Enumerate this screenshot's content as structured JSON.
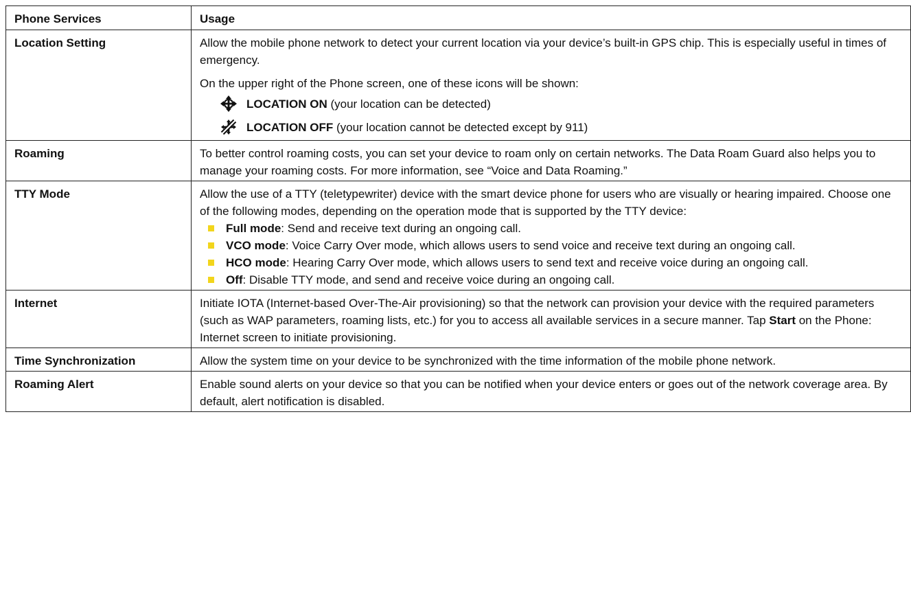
{
  "header": {
    "col1": "Phone Services",
    "col2": "Usage"
  },
  "rows": {
    "location": {
      "label": "Location Setting",
      "p1": "Allow the mobile phone network to detect your current location via your device’s built-in GPS chip. This is especially useful in times of emergency.",
      "p2": "On the upper right of the Phone screen, one of these icons will be shown:",
      "on_bold": "LOCATION ON",
      "on_text": " (your location can be detected)",
      "off_bold": "LOCATION OFF",
      "off_text": " (your location cannot be detected except by 911)"
    },
    "roaming": {
      "label": "Roaming",
      "text": "To better control roaming costs, you can set your device to roam only on certain networks. The Data Roam Guard also helps you to manage your roaming costs. For more information, see “Voice and Data Roaming.”"
    },
    "tty": {
      "label": "TTY Mode",
      "intro": "Allow the use of a TTY (teletypewriter) device with the smart device phone for users who are visually or hearing impaired. Choose one of the following modes, depending on the operation mode that is supported by the TTY device:",
      "bullets": [
        {
          "term": "Full mode",
          "text": ": Send and receive text during an ongoing call."
        },
        {
          "term": "VCO mode",
          "text": ": Voice Carry Over mode, which allows users to send voice and receive text during an ongoing call."
        },
        {
          "term": "HCO mode",
          "text": ": Hearing Carry Over mode, which allows users to send text and receive voice during an ongoing call."
        },
        {
          "term": "Off",
          "text": ": Disable TTY mode, and send and receive voice during an ongoing call."
        }
      ]
    },
    "internet": {
      "label": "Internet",
      "text_a": "Initiate IOTA (Internet-based Over-The-Air provisioning) so that the network can provision your device with the required parameters (such as WAP parameters, roaming lists, etc.) for you to access all available services in a secure manner. Tap ",
      "bold": "Start",
      "text_b": " on the Phone: Internet screen to initiate provisioning."
    },
    "time": {
      "label": "Time Synchronization",
      "text": "Allow the system time on your device to be synchronized with the time information of the mobile phone network."
    },
    "alert": {
      "label": "Roaming Alert",
      "text": "Enable sound alerts on your device so that you can be notified when your device enters or goes out of the network coverage area. By default, alert notification is disabled."
    }
  },
  "icons": {
    "location_on": "location-on-icon",
    "location_off": "location-off-icon"
  },
  "colors": {
    "bullet": "#f2d51c",
    "border": "#222222",
    "text": "#111111"
  }
}
